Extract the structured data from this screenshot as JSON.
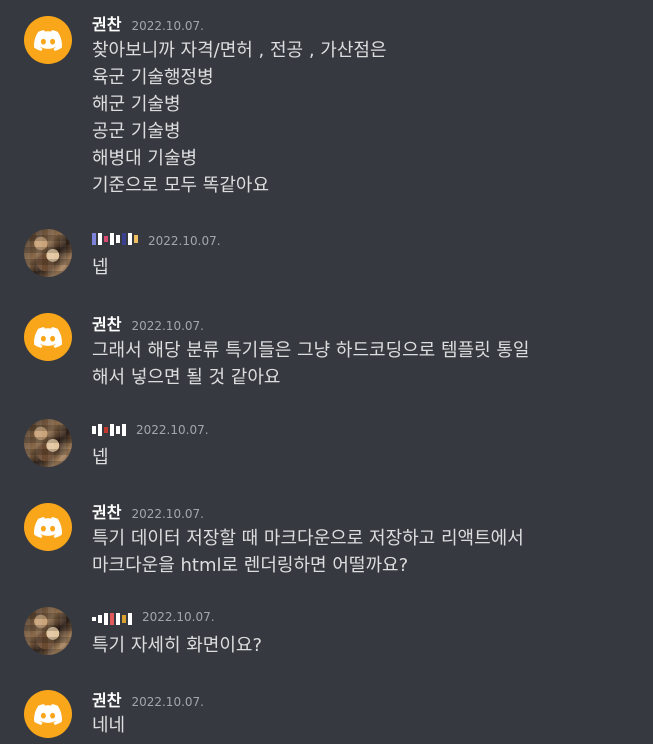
{
  "colors": {
    "background": "#36393f",
    "discord_avatar": "#faa61a",
    "text": "#dcddde",
    "name": "#ffffff",
    "timestamp": "#a3a6aa"
  },
  "messages": [
    {
      "author": "권찬",
      "avatar": "discord-logo-icon",
      "time": "2022.10.07.",
      "lines": [
        "찾아보니까 자격/면허 , 전공 , 가산점은",
        "육군 기술행정병",
        "해군 기술병",
        "공군 기술병",
        "해병대 기술병",
        "기준으로 모두 똑같아요"
      ]
    },
    {
      "author": "",
      "avatar": "photo-avatar",
      "time": "2022.10.07.",
      "lines": [
        "넵"
      ]
    },
    {
      "author": "권찬",
      "avatar": "discord-logo-icon",
      "time": "2022.10.07.",
      "lines": [
        "그래서 해당 분류 특기들은 그냥 하드코딩으로 템플릿 통일",
        "해서 넣으면 될 것 같아요"
      ]
    },
    {
      "author": "",
      "avatar": "photo-avatar",
      "time": "2022.10.07.",
      "lines": [
        "넵"
      ]
    },
    {
      "author": "권찬",
      "avatar": "discord-logo-icon",
      "time": "2022.10.07.",
      "lines": [
        "특기 데이터 저장할 때 마크다운으로 저장하고 리액트에서",
        "마크다운을 html로 렌더링하면 어떨까요?"
      ]
    },
    {
      "author": "",
      "avatar": "photo-avatar",
      "time": "2022.10.07.",
      "lines": [
        "특기 자세히 화면이요?"
      ]
    },
    {
      "author": "권찬",
      "avatar": "discord-logo-icon",
      "time": "2022.10.07.",
      "lines": [
        "네네"
      ]
    }
  ]
}
